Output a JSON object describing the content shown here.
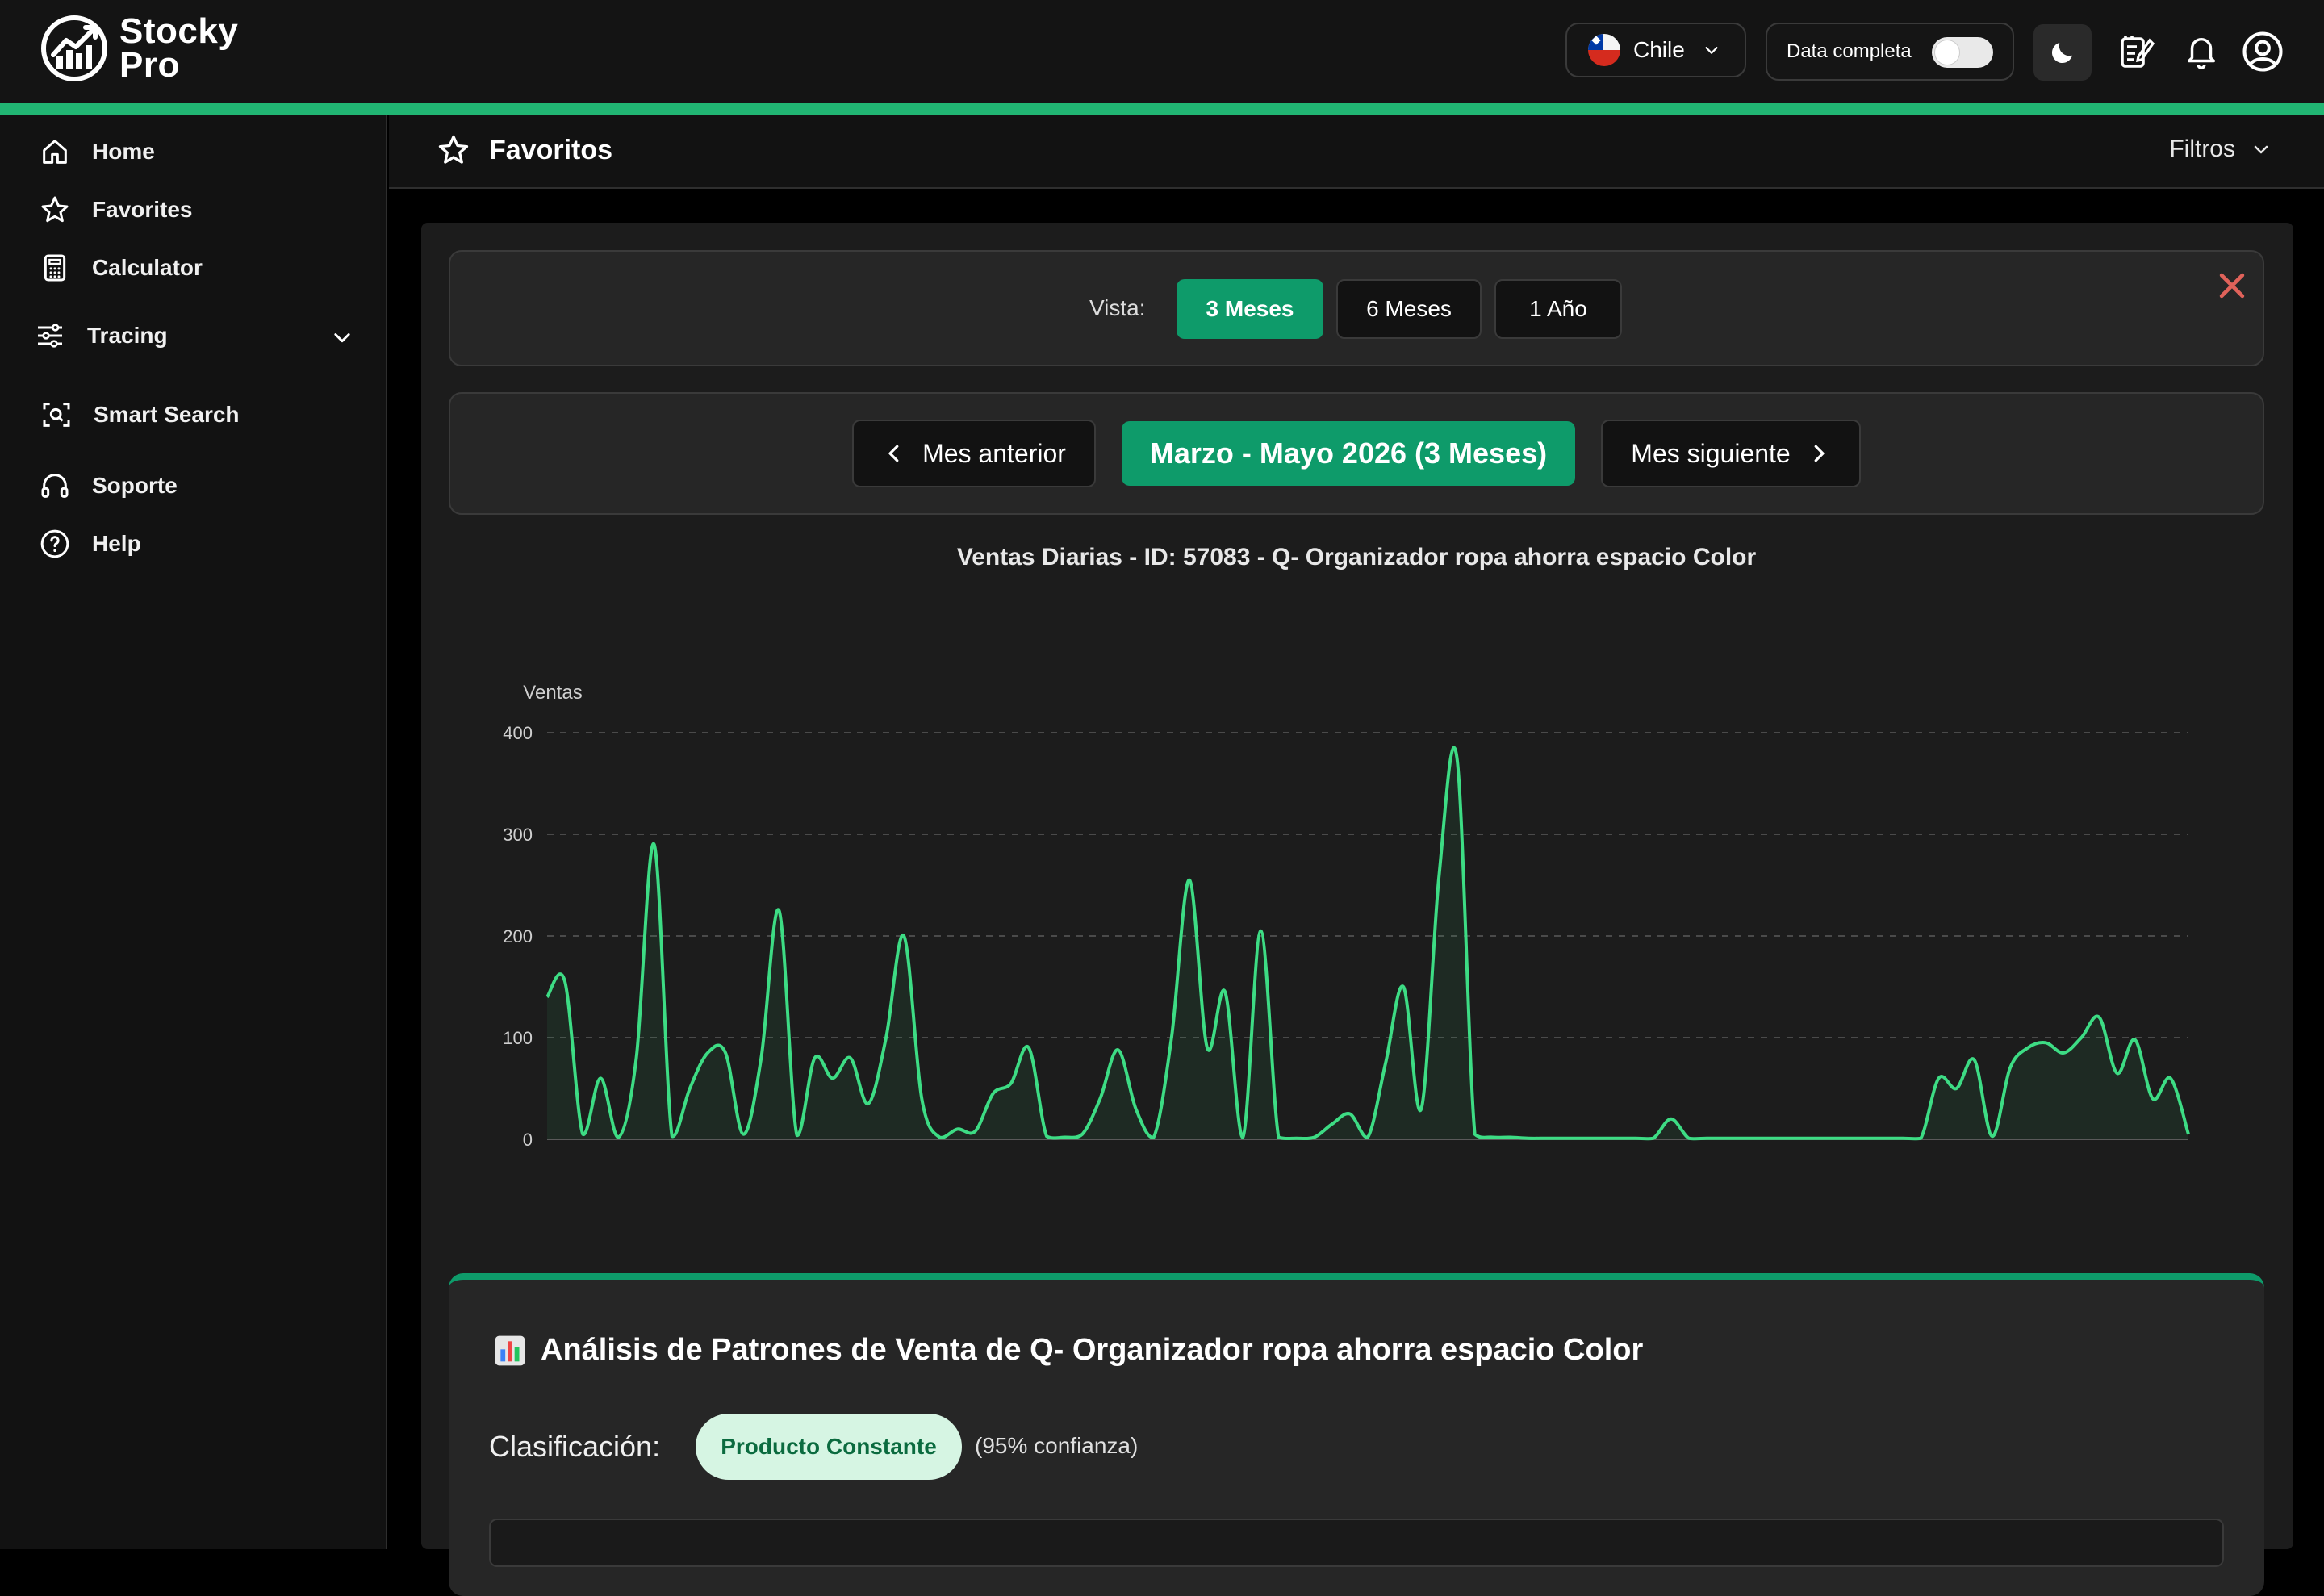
{
  "app": {
    "logo_line1": "Stocky",
    "logo_line2": "Pro",
    "icon": "stocky-chart-logo-icon"
  },
  "header": {
    "country": "Chile",
    "country_flag": "chile-flag-icon",
    "data_toggle_label": "Data completa",
    "data_toggle_on": false,
    "icons": [
      "moon-icon",
      "notes-icon",
      "bell-icon",
      "user-icon"
    ]
  },
  "sidebar": {
    "items": [
      {
        "label": "Home",
        "icon": "home-icon"
      },
      {
        "label": "Favorites",
        "icon": "star-icon"
      },
      {
        "label": "Calculator",
        "icon": "calculator-icon"
      },
      {
        "label": "Tracing",
        "icon": "sliders-icon",
        "expandable": true
      },
      {
        "label": "Smart Search",
        "icon": "scan-search-icon"
      },
      {
        "label": "Soporte",
        "icon": "headset-icon"
      },
      {
        "label": "Help",
        "icon": "help-circle-icon"
      }
    ]
  },
  "page": {
    "title": "Favoritos",
    "filters_label": "Filtros"
  },
  "view_selector": {
    "label": "Vista:",
    "options": [
      "3 Meses",
      "6 Meses",
      "1 Año"
    ],
    "selected": "3 Meses"
  },
  "period_nav": {
    "prev_label": "Mes anterior",
    "current_label": "Marzo - Mayo 2026 (3 Meses)",
    "next_label": "Mes siguiente"
  },
  "colors": {
    "accent": "#21b573",
    "button_green": "#0e9b6a",
    "line": "#3ddc84",
    "close": "#e0625a"
  },
  "chart_data": {
    "type": "area",
    "title": "Ventas Diarias - ID: 57083 - Q- Organizador ropa ahorra espacio Color",
    "ylabel": "Ventas",
    "xlabel": "",
    "ylim": [
      0,
      400
    ],
    "yticks": [
      0,
      100,
      200,
      300,
      400
    ],
    "grid": true,
    "series": [
      {
        "values": [
          140,
          155,
          5,
          60,
          2,
          80,
          290,
          3,
          50,
          85,
          85,
          5,
          80,
          225,
          4,
          80,
          60,
          80,
          35,
          100,
          200,
          40,
          2,
          10,
          8,
          45,
          55,
          90,
          3,
          2,
          5,
          40,
          88,
          30,
          2,
          100,
          255,
          90,
          145,
          2,
          205,
          2,
          1,
          2,
          15,
          25,
          2,
          75,
          150,
          30,
          260,
          375,
          5,
          2,
          2,
          1,
          1,
          1,
          1,
          1,
          1,
          1,
          1,
          20,
          1,
          1,
          1,
          1,
          1,
          1,
          1,
          1,
          1,
          1,
          1,
          1,
          1,
          1,
          60,
          50,
          78,
          3,
          70,
          90,
          95,
          85,
          100,
          120,
          65,
          98,
          40,
          60,
          5
        ]
      }
    ]
  },
  "analysis": {
    "icon": "bar-chart-emoji-icon",
    "title": "Análisis de Patrones de Venta de Q- Organizador ropa ahorra espacio Color",
    "classification_label": "Clasificación:",
    "classification_value": "Producto Constante",
    "confidence": "(95% confianza)"
  }
}
